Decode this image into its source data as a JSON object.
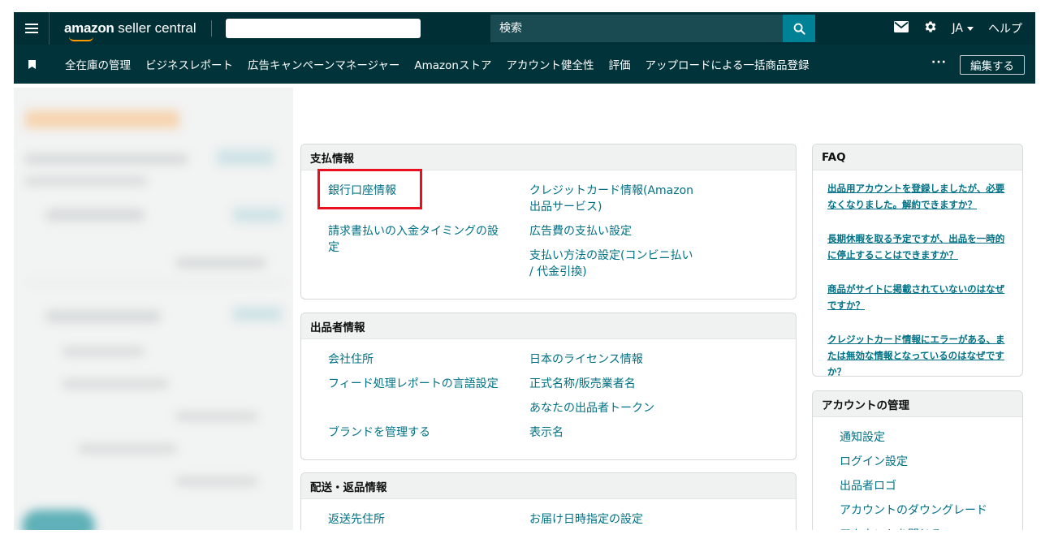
{
  "topbar": {
    "logo_bold": "amazon",
    "logo_rest": " seller central",
    "search_placeholder": "検索",
    "language": "JA",
    "help": "ヘルプ"
  },
  "navbar": {
    "items": [
      "全在庫の管理",
      "ビジネスレポート",
      "広告キャンペーンマネージャー",
      "Amazonストア",
      "アカウント健全性",
      "評価",
      "アップロードによる一括商品登録"
    ],
    "more": "···",
    "edit": "編集する"
  },
  "payment": {
    "title": "支払情報",
    "links": [
      "銀行口座情報",
      "クレジットカード情報(Amazon出品サービス)",
      "請求書払いの入金タイミングの設定",
      "広告費の支払い設定",
      "支払い方法の設定(コンビニ払い / 代金引換)"
    ]
  },
  "seller": {
    "title": "出品者情報",
    "links": [
      "会社住所",
      "日本のライセンス情報",
      "フィード処理レポートの言語設定",
      "正式名称/販売業者名",
      "あなたの出品者トークン",
      "ブランドを管理する",
      "表示名"
    ]
  },
  "shipping": {
    "title": "配送・返品情報",
    "links": [
      "返送先住所",
      "お届け日時指定の設定"
    ]
  },
  "faq": {
    "title": "FAQ",
    "items": [
      "出品用アカウントを登録しましたが、必要なくなりました。解約できますか？",
      "長期休暇を取る予定ですが、出品を一時的に停止することはできますか？",
      "商品がサイトに掲載されていないのはなぜですか？",
      "クレジットカード情報にエラーがある、または無効な情報となっているのはなぜですか？"
    ]
  },
  "account": {
    "title": "アカウントの管理",
    "items": [
      "通知設定",
      "ログイン設定",
      "出品者ロゴ",
      "アカウントのダウングレード",
      "アカウントを閉じる"
    ]
  },
  "colors": {
    "topbar": "#002f36",
    "navbar": "#00343a",
    "link": "#007185",
    "highlight": "#e8101e"
  }
}
